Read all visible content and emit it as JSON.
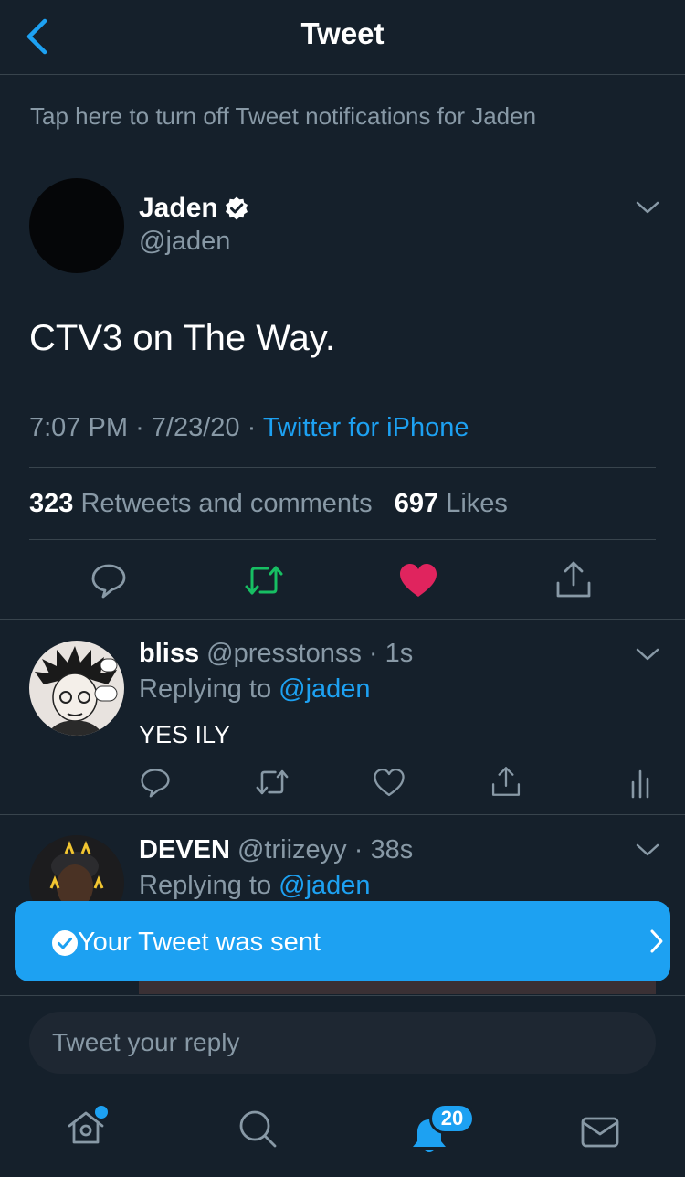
{
  "header": {
    "title": "Tweet"
  },
  "notification_link": "Tap here to turn off Tweet notifications for Jaden",
  "tweet": {
    "author_name": "Jaden",
    "author_handle": "@jaden",
    "text": "CTV3 on The Way.",
    "time": "7:07 PM",
    "date": "7/23/20",
    "source": "Twitter for iPhone",
    "retweets_count": "323",
    "retweets_label": "Retweets and comments",
    "likes_count": "697",
    "likes_label": "Likes",
    "liked": true
  },
  "replies": [
    {
      "name": "bliss",
      "handle": "@presstonss",
      "age": "1s",
      "replying_label": "Replying to",
      "replying_to": "@jaden",
      "text": "YES ILY"
    },
    {
      "name": "DEVEN",
      "handle": "@triizeyy",
      "age": "38s",
      "replying_label": "Replying to",
      "replying_to": "@jaden"
    }
  ],
  "toast": {
    "text": "Your Tweet was sent"
  },
  "composer": {
    "placeholder": "Tweet your reply"
  },
  "tabbar": {
    "notifications_badge": "20"
  },
  "colors": {
    "background": "#15202b",
    "accent": "#1da1f2",
    "retweet": "#17bf63",
    "like": "#e0245e",
    "secondary_text": "#8899a6",
    "divider": "#38444d"
  }
}
